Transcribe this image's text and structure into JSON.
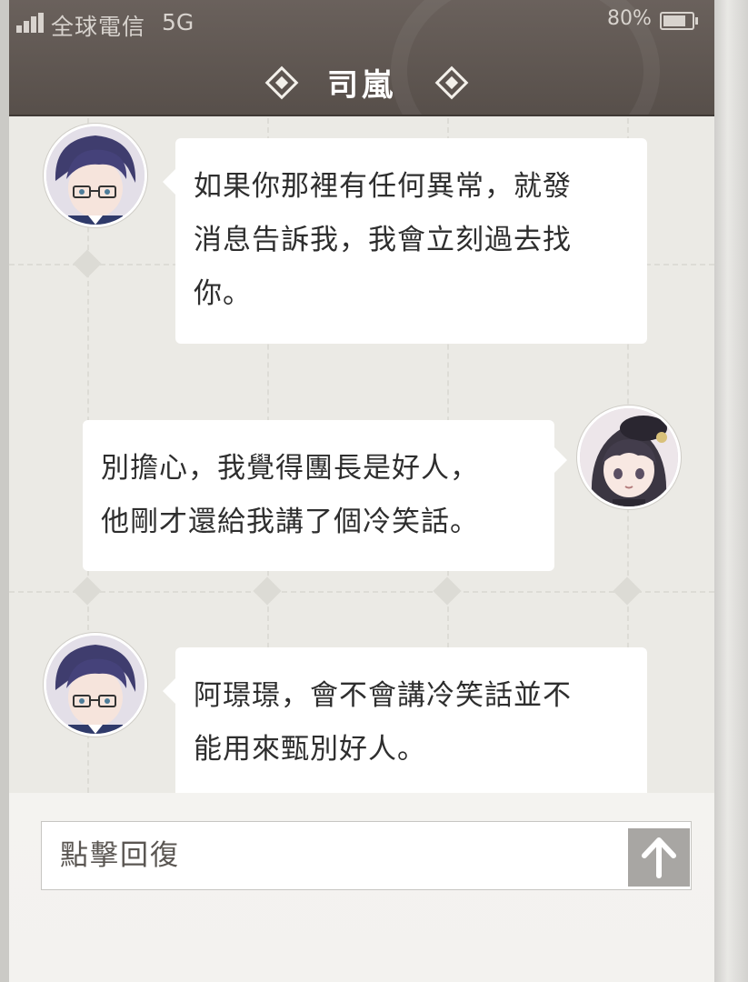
{
  "status_bar": {
    "carrier": "全球電信",
    "network": "5G",
    "battery_percent": "80%",
    "battery_level": 0.8,
    "signal_icon": "signal-bars-icon",
    "battery_icon": "battery-icon"
  },
  "header": {
    "title": "司嵐",
    "decoration_icon": "diamond-ornament-icon"
  },
  "messages": [
    {
      "sender": "contact",
      "avatar_icon": "contact-avatar",
      "lines": [
        "如果你那裡有任何異常，就發",
        "消息告訴我，我會立刻過去找",
        "你。"
      ]
    },
    {
      "sender": "me",
      "avatar_icon": "user-avatar",
      "lines": [
        "別擔心，我覺得團長是好人，",
        "他剛才還給我講了個冷笑話。"
      ]
    },
    {
      "sender": "contact",
      "avatar_icon": "contact-avatar",
      "lines": [
        "阿璟璟，會不會講冷笑話並不",
        "能用來甄別好人。"
      ]
    }
  ],
  "reply": {
    "placeholder": "點擊回復",
    "send_icon": "arrow-up-icon"
  },
  "colors": {
    "header_bg": "#5e5651",
    "chat_bg": "#ebeae5",
    "bubble_bg": "#ffffff",
    "send_button": "#a8a6a3"
  }
}
